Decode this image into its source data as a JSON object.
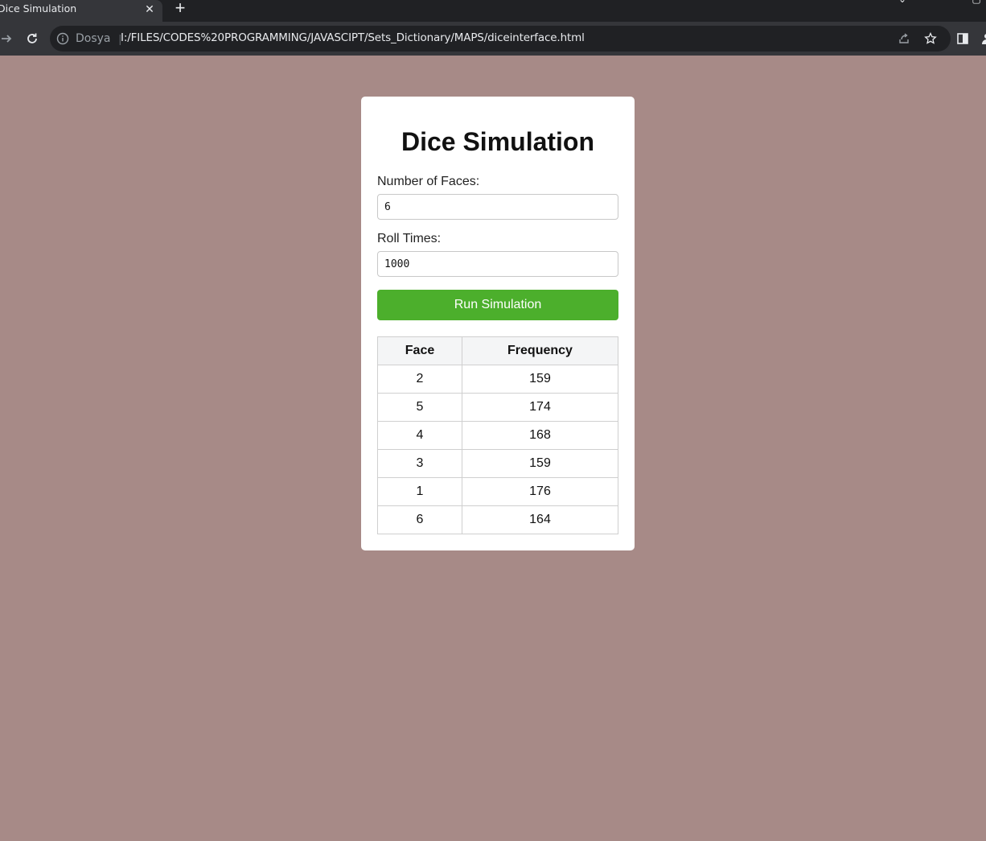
{
  "browser": {
    "tab_title": "Dice Simulation",
    "tab_close_icon": "close-icon",
    "new_tab_icon": "plus-icon",
    "site_info_label": "Dosya",
    "url": "I:/FILES/CODES%20PROGRAMMING/JAVASCIPT/Sets_Dictionary/MAPS/diceinterface.html",
    "background": "#a78a87"
  },
  "app": {
    "title": "Dice Simulation",
    "faces_label": "Number of Faces:",
    "faces_value": "6",
    "roll_label": "Roll Times:",
    "roll_value": "1000",
    "run_button": "Run Simulation",
    "accent": "#4caf2c"
  },
  "results": {
    "headers": [
      "Face",
      "Frequency"
    ],
    "rows": [
      {
        "face": "2",
        "frequency": "159"
      },
      {
        "face": "5",
        "frequency": "174"
      },
      {
        "face": "4",
        "frequency": "168"
      },
      {
        "face": "3",
        "frequency": "159"
      },
      {
        "face": "1",
        "frequency": "176"
      },
      {
        "face": "6",
        "frequency": "164"
      }
    ]
  }
}
